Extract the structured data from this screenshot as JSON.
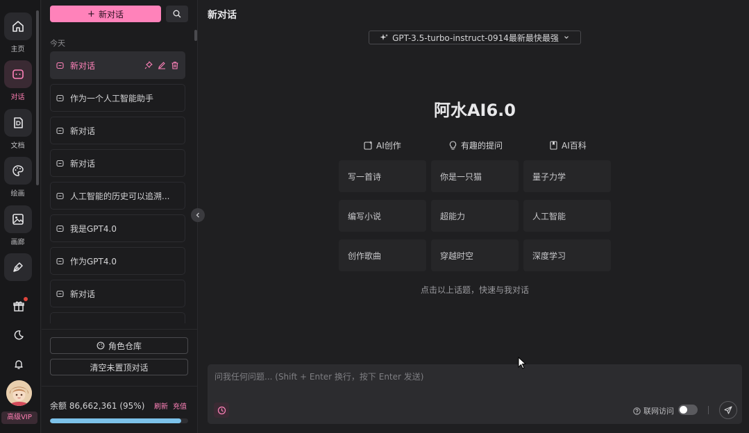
{
  "rail": {
    "items": [
      {
        "label": "主页",
        "icon": "home-icon"
      },
      {
        "label": "对话",
        "icon": "chat-icon"
      },
      {
        "label": "文档",
        "icon": "document-icon"
      },
      {
        "label": "绘画",
        "icon": "palette-icon"
      },
      {
        "label": "画廊",
        "icon": "gallery-icon"
      },
      {
        "label": "",
        "icon": "pen-tool-icon"
      }
    ],
    "vip_label": "高级VIP"
  },
  "panel": {
    "new_chat_label": "新对话",
    "section_label": "今天",
    "conversations": [
      {
        "title": "新对话"
      },
      {
        "title": "作为一个人工智能助手"
      },
      {
        "title": "新对话"
      },
      {
        "title": "新对话"
      },
      {
        "title": "人工智能的历史可以追溯..."
      },
      {
        "title": "我是GPT4.0"
      },
      {
        "title": "作为GPT4.0"
      },
      {
        "title": "新对话"
      }
    ],
    "role_store_label": "角色仓库",
    "clear_label": "清空未置顶对话",
    "balance_text": "余额 86,662,361 (95%)",
    "balance_fraction": 0.95,
    "refresh_label": "刷新",
    "recharge_label": "充值"
  },
  "main": {
    "title": "新对话",
    "model": "GPT-3.5-turbo-instruct-0914最新最快最强",
    "hero_title": "阿水AI6.0",
    "categories": [
      {
        "label": "AI创作",
        "icon": "edit-square-icon"
      },
      {
        "label": "有趣的提问",
        "icon": "lightbulb-icon"
      },
      {
        "label": "AI百科",
        "icon": "book-icon"
      }
    ],
    "topics": [
      "写一首诗",
      "你是一只猫",
      "量子力学",
      "编写小说",
      "超能力",
      "人工智能",
      "创作歌曲",
      "穿越时空",
      "深度学习"
    ],
    "hint": "点击以上话题，快速与我对话",
    "input_placeholder": "问我任何问题... (Shift + Enter 换行，按下 Enter 发送)",
    "web_access_label": "联网访问",
    "web_access_on": false
  },
  "colors": {
    "accent": "#ff82ba",
    "progress": "#7cc2ea"
  }
}
